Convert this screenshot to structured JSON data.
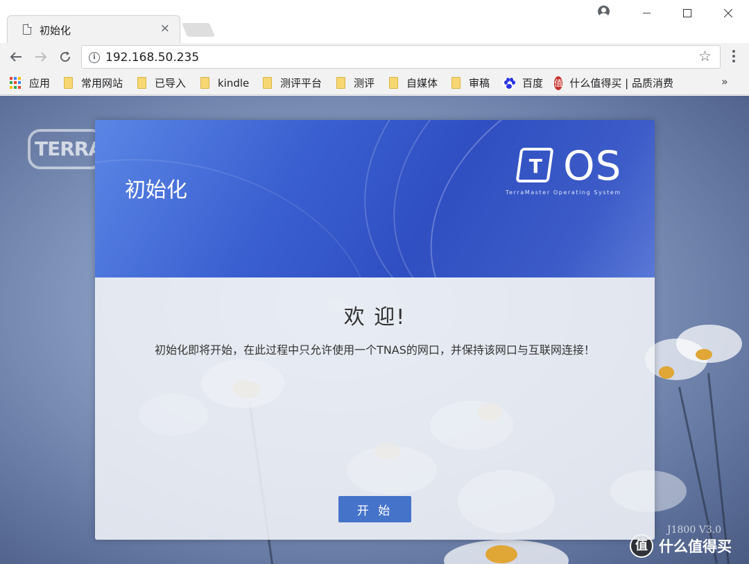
{
  "browser": {
    "tab": {
      "title": "初始化",
      "close": "×"
    },
    "window_controls": {
      "minimize": "—",
      "maximize": "☐",
      "close": "✕"
    },
    "address_bar": {
      "url": "192.168.50.235"
    },
    "bookmarks": [
      {
        "label": "应用",
        "icon": "apps-icon"
      },
      {
        "label": "常用网站",
        "icon": "folder-icon"
      },
      {
        "label": "已导入",
        "icon": "folder-icon"
      },
      {
        "label": "kindle",
        "icon": "folder-icon"
      },
      {
        "label": "测评平台",
        "icon": "folder-icon"
      },
      {
        "label": "测评",
        "icon": "folder-icon"
      },
      {
        "label": "自媒体",
        "icon": "folder-icon"
      },
      {
        "label": "审稿",
        "icon": "folder-icon"
      },
      {
        "label": "百度",
        "icon": "baidu-icon"
      },
      {
        "label": "什么值得买 | 品质消费",
        "icon": "smzdm-icon"
      }
    ],
    "bookmarks_overflow": "»"
  },
  "page": {
    "brand_logo": "TERRAMASTER",
    "model": "J1800  V3.0",
    "watermark": {
      "icon_text": "值",
      "text": "什么值得买"
    }
  },
  "dialog": {
    "title": "初始化",
    "logo": {
      "letter": "T",
      "name": "OS",
      "subtitle": "TerraMaster Operating System"
    },
    "welcome": "欢 迎!",
    "message": "初始化即将开始，在此过程中只允许使用一个TNAS的网口，并保持该网口与互联网连接！",
    "start_button": "开 始"
  },
  "colors": {
    "header_blue": "#3a5fd0",
    "button_blue": "#4573c9",
    "folder_yellow": "#f7d774"
  }
}
